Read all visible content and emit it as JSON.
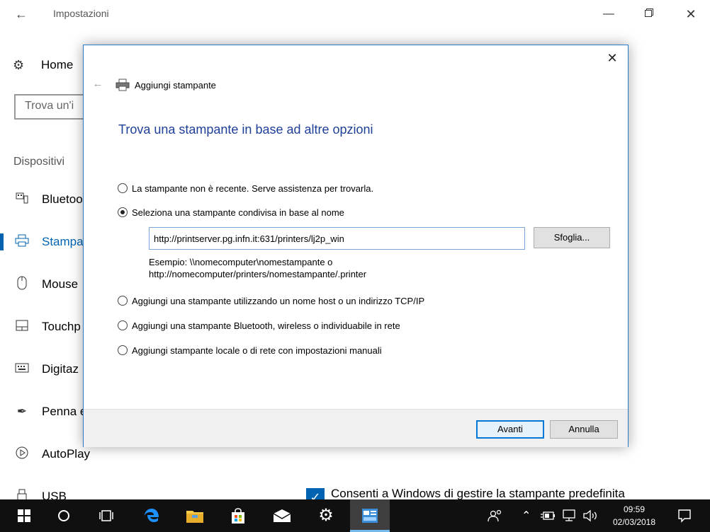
{
  "settings": {
    "title": "Impostazioni",
    "home_label": "Home",
    "search_placeholder": "Trova un'i",
    "section_heading": "Dispositivi",
    "nav": [
      {
        "label": "Bluetoo",
        "icon": "bluetooth-devices-icon"
      },
      {
        "label": "Stampa",
        "icon": "printer-icon"
      },
      {
        "label": "Mouse",
        "icon": "mouse-icon"
      },
      {
        "label": "Touchp",
        "icon": "touchpad-icon"
      },
      {
        "label": "Digitaz",
        "icon": "keyboard-icon"
      },
      {
        "label": "Penna e",
        "icon": "pen-icon"
      },
      {
        "label": "AutoPlay",
        "icon": "autoplay-icon"
      },
      {
        "label": "USB",
        "icon": "usb-icon"
      }
    ],
    "default_printer_checkbox_label": "Consenti a Windows di gestire la stampante predefinita"
  },
  "dialog": {
    "title": "Aggiungi stampante",
    "heading": "Trova una stampante in base ad altre opzioni",
    "options": [
      {
        "label": "La stampante non è recente. Serve assistenza per trovarla.",
        "checked": false
      },
      {
        "label": "Seleziona una stampante condivisa in base al nome",
        "checked": true
      },
      {
        "label": "Aggiungi una stampante utilizzando un nome host o un indirizzo TCP/IP",
        "checked": false
      },
      {
        "label": "Aggiungi una stampante Bluetooth, wireless o individuabile in rete",
        "checked": false
      },
      {
        "label": "Aggiungi stampante locale o di rete con impostazioni manuali",
        "checked": false
      }
    ],
    "printer_name_value": "http://printserver.pg.infn.it:631/printers/lj2p_win",
    "browse_label": "Sfoglia...",
    "example_line1": "Esempio: \\\\nomecomputer\\nomestampante o",
    "example_line2": "http://nomecomputer/printers/nomestampante/.printer",
    "next_label": "Avanti",
    "cancel_label": "Annulla"
  },
  "taskbar": {
    "time": "09:59",
    "date": "02/03/2018",
    "accent_color": "#0078d7"
  }
}
